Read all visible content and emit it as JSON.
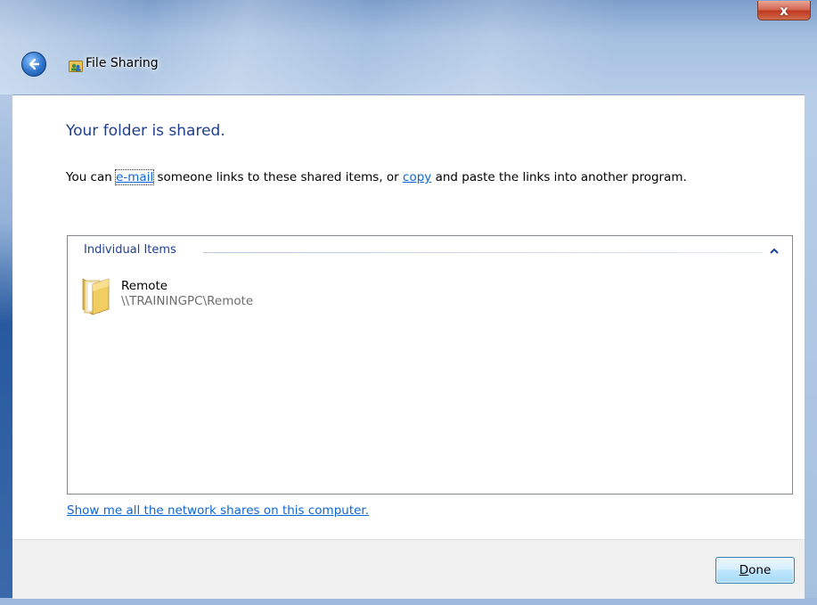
{
  "window": {
    "title": "File Sharing",
    "close_label": "x"
  },
  "main": {
    "heading": "Your folder is shared.",
    "instruction_prefix": "You can",
    "email_link": "e-mail",
    "instruction_mid": "someone links to these shared items, or",
    "copy_link": "copy",
    "instruction_suffix": "and paste the links into another program."
  },
  "items_panel": {
    "group_header": "Individual Items",
    "items": [
      {
        "name": "Remote",
        "path": "\\\\TRAININGPC\\Remote",
        "icon": "folder-icon"
      }
    ]
  },
  "network_shares_link": "Show me all the network shares on this computer.",
  "footer": {
    "done_accesskey": "D",
    "done_rest": "one"
  },
  "colors": {
    "heading": "#1f3f8a",
    "link": "#0b66d6",
    "group_header": "#1e3f9a"
  }
}
